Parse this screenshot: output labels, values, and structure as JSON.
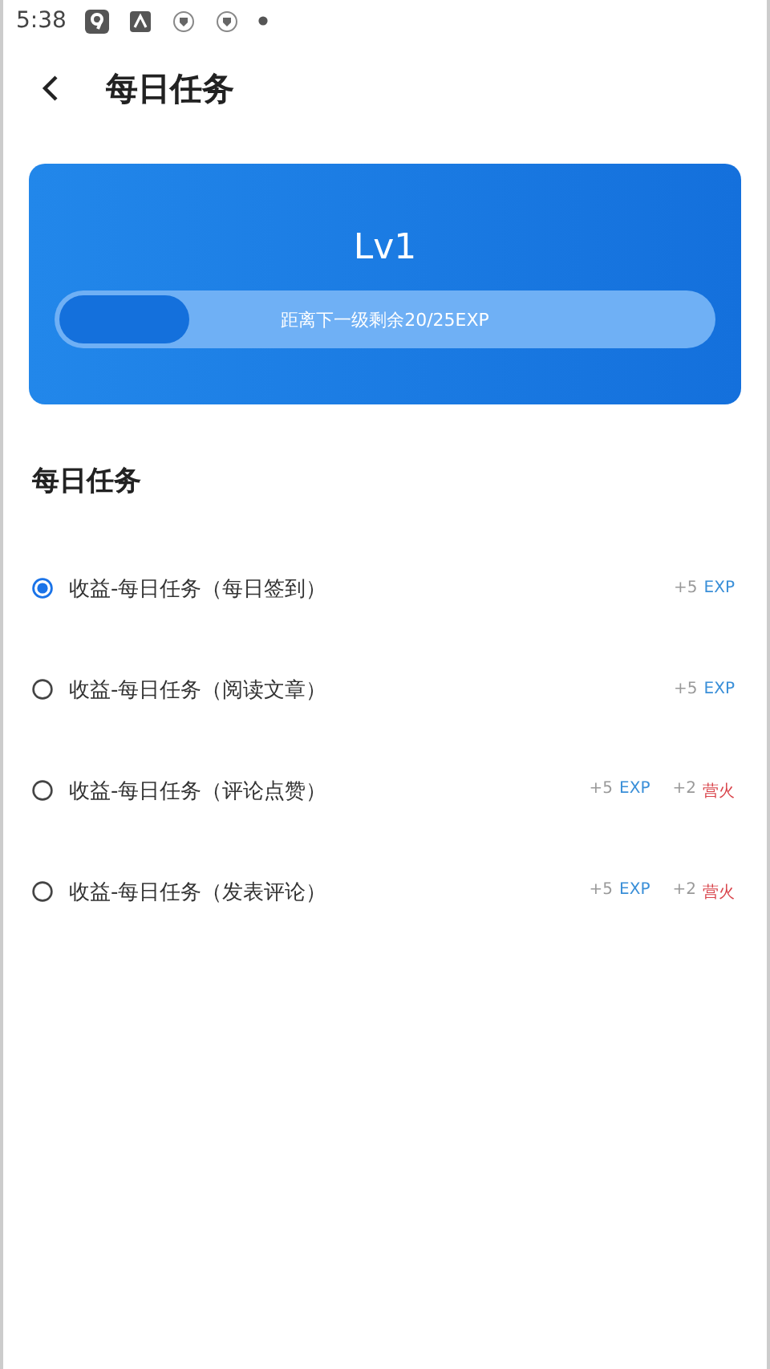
{
  "status_bar": {
    "time": "5:38"
  },
  "header": {
    "title": "每日任务"
  },
  "level_card": {
    "level": "Lv1",
    "progress": {
      "level": 0.2,
      "caption": "距离下一级剩余20/25EXP"
    }
  },
  "section": {
    "title": "每日任务"
  },
  "tasks": [
    {
      "label": "收益-每日任务（每日签到）",
      "selected": true,
      "rewards": [
        {
          "amount": "+5",
          "unit": "EXP",
          "kind": "exp"
        }
      ]
    },
    {
      "label": "收益-每日任务（阅读文章）",
      "selected": false,
      "rewards": [
        {
          "amount": "+5",
          "unit": "EXP",
          "kind": "exp"
        }
      ]
    },
    {
      "label": "收益-每日任务（评论点赞）",
      "selected": false,
      "rewards": [
        {
          "amount": "+5",
          "unit": "EXP",
          "kind": "exp"
        },
        {
          "amount": "+2",
          "unit": "营火",
          "kind": "fire"
        }
      ]
    },
    {
      "label": "收益-每日任务（发表评论）",
      "selected": false,
      "rewards": [
        {
          "amount": "+5",
          "unit": "EXP",
          "kind": "exp"
        },
        {
          "amount": "+2",
          "unit": "营火",
          "kind": "fire"
        }
      ]
    }
  ]
}
